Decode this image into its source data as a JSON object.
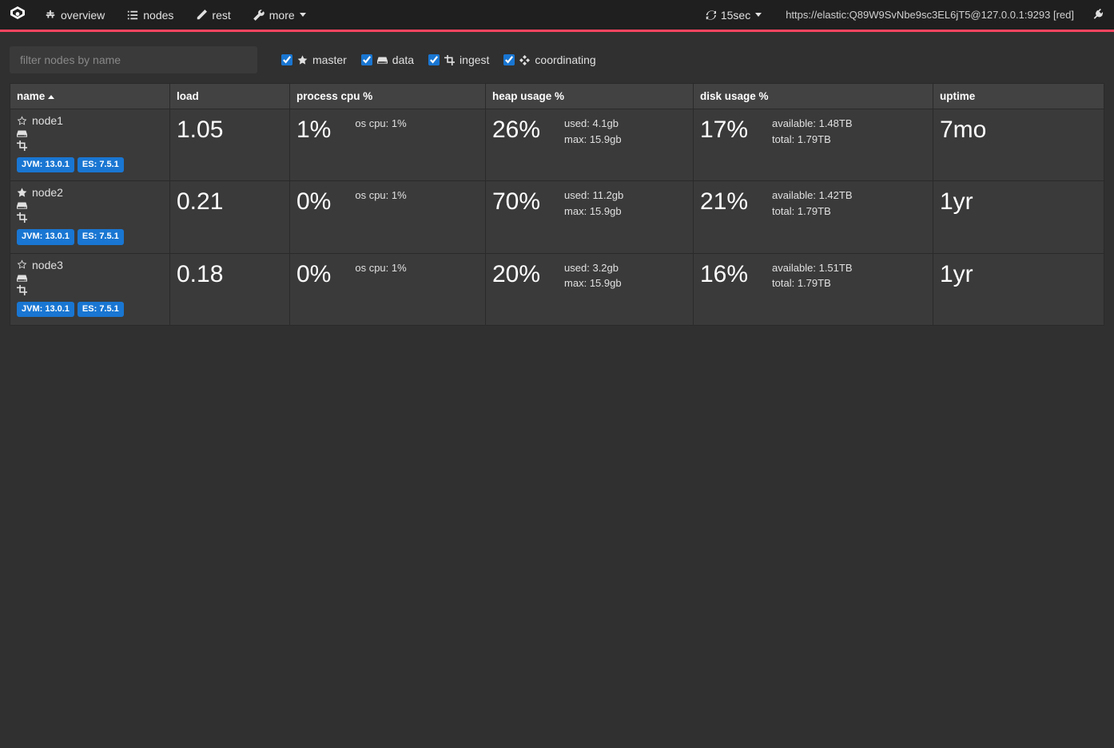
{
  "nav": {
    "overview": "overview",
    "nodes": "nodes",
    "rest": "rest",
    "more": "more",
    "refresh_rate": "15sec",
    "host": "https://elastic:Q89W9SvNbe9sc3EL6jT5@127.0.0.1:9293 [red]"
  },
  "filter": {
    "placeholder": "filter nodes by name",
    "master": "master",
    "data": "data",
    "ingest": "ingest",
    "coordinating": "coordinating"
  },
  "columns": {
    "name": "name",
    "load": "load",
    "cpu": "process cpu %",
    "heap": "heap usage %",
    "disk": "disk usage %",
    "uptime": "uptime"
  },
  "nodes": [
    {
      "name": "node1",
      "master_eligible": true,
      "current_master": false,
      "jvm": "JVM: 13.0.1",
      "es": "ES: 7.5.1",
      "load": "1.05",
      "cpu": "1%",
      "os_cpu": "os cpu: 1%",
      "heap": "26%",
      "heap_used": "used: 4.1gb",
      "heap_max": "max: 15.9gb",
      "disk": "17%",
      "disk_available": "available: 1.48TB",
      "disk_total": "total: 1.79TB",
      "uptime": "7mo"
    },
    {
      "name": "node2",
      "master_eligible": true,
      "current_master": true,
      "jvm": "JVM: 13.0.1",
      "es": "ES: 7.5.1",
      "load": "0.21",
      "cpu": "0%",
      "os_cpu": "os cpu: 1%",
      "heap": "70%",
      "heap_used": "used: 11.2gb",
      "heap_max": "max: 15.9gb",
      "disk": "21%",
      "disk_available": "available: 1.42TB",
      "disk_total": "total: 1.79TB",
      "uptime": "1yr"
    },
    {
      "name": "node3",
      "master_eligible": true,
      "current_master": false,
      "jvm": "JVM: 13.0.1",
      "es": "ES: 7.5.1",
      "load": "0.18",
      "cpu": "0%",
      "os_cpu": "os cpu: 1%",
      "heap": "20%",
      "heap_used": "used: 3.2gb",
      "heap_max": "max: 15.9gb",
      "disk": "16%",
      "disk_available": "available: 1.51TB",
      "disk_total": "total: 1.79TB",
      "uptime": "1yr"
    }
  ]
}
